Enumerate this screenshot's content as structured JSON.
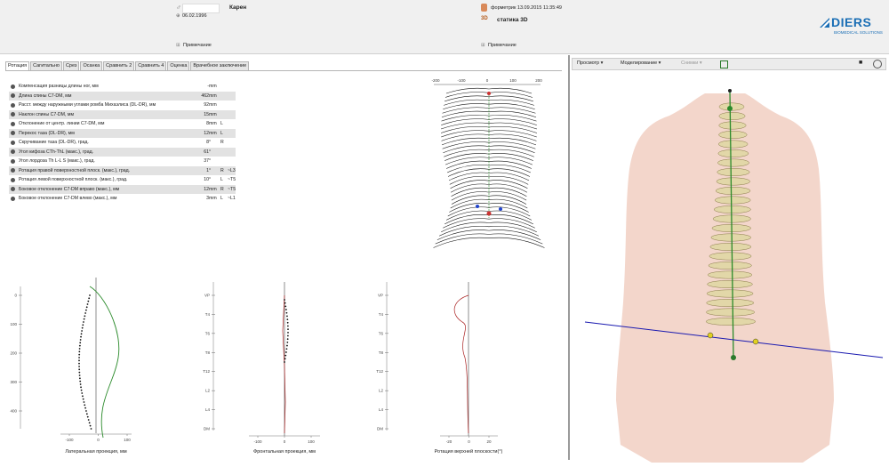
{
  "patient": {
    "icon": "male-symbol-icon",
    "name": "Карен",
    "birth_date": "06.02.1996"
  },
  "scan": {
    "label": "форметрик 13.09.2015 11:35:49",
    "mode": "статика 3D"
  },
  "notes": {
    "left": "Примечание",
    "right": "Примечание"
  },
  "logo": {
    "brand": "DIERS",
    "sub": "BIOMEDICAL SOLUTIONS",
    "color": "#1a6eb5"
  },
  "tabs": [
    "Ротация",
    "Сагитально",
    "Срез",
    "Осанка",
    "Сравнить 2",
    "Сравнить 4",
    "Оценка",
    "Врачебное заключение"
  ],
  "params": [
    {
      "label": "Компенсация разницы длины ног, мм",
      "value": "-",
      "unit": "mm",
      "side": "",
      "level": ""
    },
    {
      "label": "Длина спины С7-DM, мм",
      "value": "462",
      "unit": "mm",
      "side": "",
      "level": ""
    },
    {
      "label": "Расст. между наружными углами ромба Михаэлиса (DL-DR), мм",
      "value": "92",
      "unit": "mm",
      "side": "",
      "level": ""
    },
    {
      "label": "Наклон спины С7-DM, мм",
      "value": "15",
      "unit": "mm",
      "side": "",
      "level": ""
    },
    {
      "label": "Отклонение от центр. линии С7-DM, мм",
      "value": "8",
      "unit": "mm",
      "side": "L",
      "level": ""
    },
    {
      "label": "Перекос таза (DL-DR), мм",
      "value": "12",
      "unit": "mm",
      "side": "L",
      "level": ""
    },
    {
      "label": "Скручивание таза (DL-DR), град.",
      "value": "8",
      "unit": "°",
      "side": "R",
      "level": ""
    },
    {
      "label": "Угол кифоза CTh-ThL (макс.), град.",
      "value": "61",
      "unit": "°",
      "side": "",
      "level": ""
    },
    {
      "label": "Угол лордоза Th L-L S (макс.), град.",
      "value": "37",
      "unit": "°",
      "side": "",
      "level": ""
    },
    {
      "label": "Ротация правой поверхностной плоск. (макс.), град.",
      "value": "1",
      "unit": "°",
      "side": "R",
      "level": "~L3"
    },
    {
      "label": "Ротация левой поверхностной плоск. (макс.), град.",
      "value": "10",
      "unit": "°",
      "side": "L",
      "level": "~T5"
    },
    {
      "label": "Боковое отклонение С7-DM вправо (макс.), мм",
      "value": "12",
      "unit": "mm",
      "side": "R",
      "level": "~T5"
    },
    {
      "label": "Боковое отклонение С7-DM влево (макс.), мм",
      "value": "3",
      "unit": "mm",
      "side": "L",
      "level": "~L1"
    }
  ],
  "topo": {
    "ticks": [
      "-200",
      "-100",
      "0",
      "100",
      "200"
    ]
  },
  "charts": {
    "lateral": {
      "caption": "Латеральная проекция, мм",
      "y_ticks": [
        "0",
        "100",
        "200",
        "300",
        "400"
      ],
      "x_ticks": [
        "-100",
        "0",
        "100"
      ]
    },
    "frontal": {
      "caption": "Фронтальная проекция, мм",
      "y_ticks": [
        "VP",
        "T4",
        "T6",
        "T8",
        "T12",
        "L2",
        "L4",
        "DM"
      ],
      "x_ticks": [
        "-100",
        "0",
        "100"
      ]
    },
    "rotation": {
      "caption": "Ротация верхней плоскости(°)",
      "y_ticks": [
        "VP",
        "T4",
        "T6",
        "T8",
        "T12",
        "L2",
        "L4",
        "DM"
      ],
      "x_ticks": [
        "-20",
        "0",
        "20"
      ]
    }
  },
  "toolbar": {
    "view": "Просмотр",
    "modeling": "Моделирование",
    "snapshots": "Снимки",
    "doc_icon": "document-icon",
    "camera_icon": "camera-icon",
    "circle_icon": "circle-icon"
  },
  "colors": {
    "spine_line": "#2a8a2a",
    "horizontal_line": "#1a1ab0",
    "torso": "#f1cfc2",
    "profile_dots": "#111111"
  }
}
